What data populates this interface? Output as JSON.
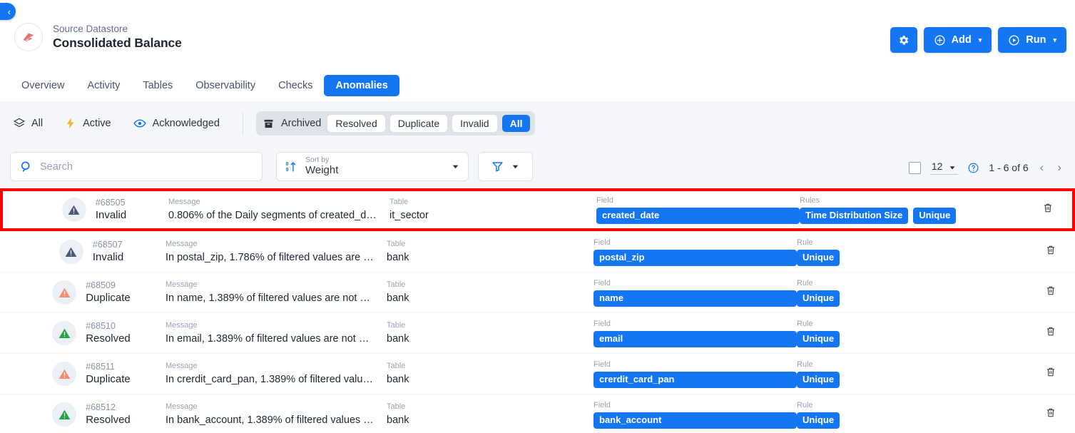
{
  "colors": {
    "brand_blue": "#1476f2",
    "highlight_red": "#ff0000",
    "status_invalid": "#4c5878",
    "status_duplicate": "#f98b71",
    "status_resolved": "#22a447",
    "page_bg": "#f4f6f9"
  },
  "back_button": {
    "label": "‹",
    "name": "back-icon"
  },
  "header": {
    "kicker": "Source Datastore",
    "title": "Consolidated Balance",
    "actions": {
      "settings_label": "",
      "add_label": "Add",
      "run_label": "Run",
      "caret": "▾"
    }
  },
  "tabs": [
    {
      "label": "Overview",
      "active": false
    },
    {
      "label": "Activity",
      "active": false
    },
    {
      "label": "Tables",
      "active": false
    },
    {
      "label": "Observability",
      "active": false
    },
    {
      "label": "Checks",
      "active": false
    },
    {
      "label": "Anomalies",
      "active": true
    }
  ],
  "quick_filters": [
    {
      "label": "All",
      "icon": "layers-icon"
    },
    {
      "label": "Active",
      "icon": "bolt-icon"
    },
    {
      "label": "Acknowledged",
      "icon": "eye-icon"
    }
  ],
  "segmented": {
    "head_label": "Archived",
    "head_icon": "archive-icon",
    "options": [
      {
        "label": "Resolved",
        "active": false
      },
      {
        "label": "Duplicate",
        "active": false
      },
      {
        "label": "Invalid",
        "active": false
      },
      {
        "label": "All",
        "active": true
      }
    ]
  },
  "search": {
    "placeholder": "Search",
    "value": ""
  },
  "sort": {
    "label": "Sort by",
    "value": "Weight"
  },
  "filter_button": {
    "label": ""
  },
  "pagination": {
    "page_size": "12",
    "range": "1 - 6 of 6",
    "prev": "‹",
    "next": "›"
  },
  "columns": {
    "message": "Message",
    "table": "Table",
    "field": "Field",
    "rules_plural": "Rules",
    "rules_singular": "Rule"
  },
  "rows": [
    {
      "id": "#68505",
      "status": "Invalid",
      "status_kind": "invalid",
      "message": "0.806% of the Daily segments of created_dat…",
      "table": "it_sector",
      "field": "created_date",
      "rules_label": "Rules",
      "rules": [
        "Time Distribution Size",
        "Unique"
      ],
      "highlighted": true
    },
    {
      "id": "#68507",
      "status": "Invalid",
      "status_kind": "invalid",
      "message": "In postal_zip, 1.786% of filtered values are not …",
      "table": "bank",
      "field": "postal_zip",
      "rules_label": "Rule",
      "rules": [
        "Unique"
      ],
      "highlighted": false
    },
    {
      "id": "#68509",
      "status": "Duplicate",
      "status_kind": "duplicate",
      "message": "In name, 1.389% of filtered values are not uniq…",
      "table": "bank",
      "field": "name",
      "rules_label": "Rule",
      "rules": [
        "Unique"
      ],
      "highlighted": false
    },
    {
      "id": "#68510",
      "status": "Resolved",
      "status_kind": "resolved",
      "message": "In email, 1.389% of filtered values are not unique",
      "table": "bank",
      "field": "email",
      "rules_label": "Rule",
      "rules": [
        "Unique"
      ],
      "highlighted": false
    },
    {
      "id": "#68511",
      "status": "Duplicate",
      "status_kind": "duplicate",
      "message": "In crerdit_card_pan, 1.389% of filtered values …",
      "table": "bank",
      "field": "crerdit_card_pan",
      "rules_label": "Rule",
      "rules": [
        "Unique"
      ],
      "highlighted": false
    },
    {
      "id": "#68512",
      "status": "Resolved",
      "status_kind": "resolved",
      "message": "In bank_account, 1.389% of filtered values are …",
      "table": "bank",
      "field": "bank_account",
      "rules_label": "Rule",
      "rules": [
        "Unique"
      ],
      "highlighted": false
    }
  ]
}
